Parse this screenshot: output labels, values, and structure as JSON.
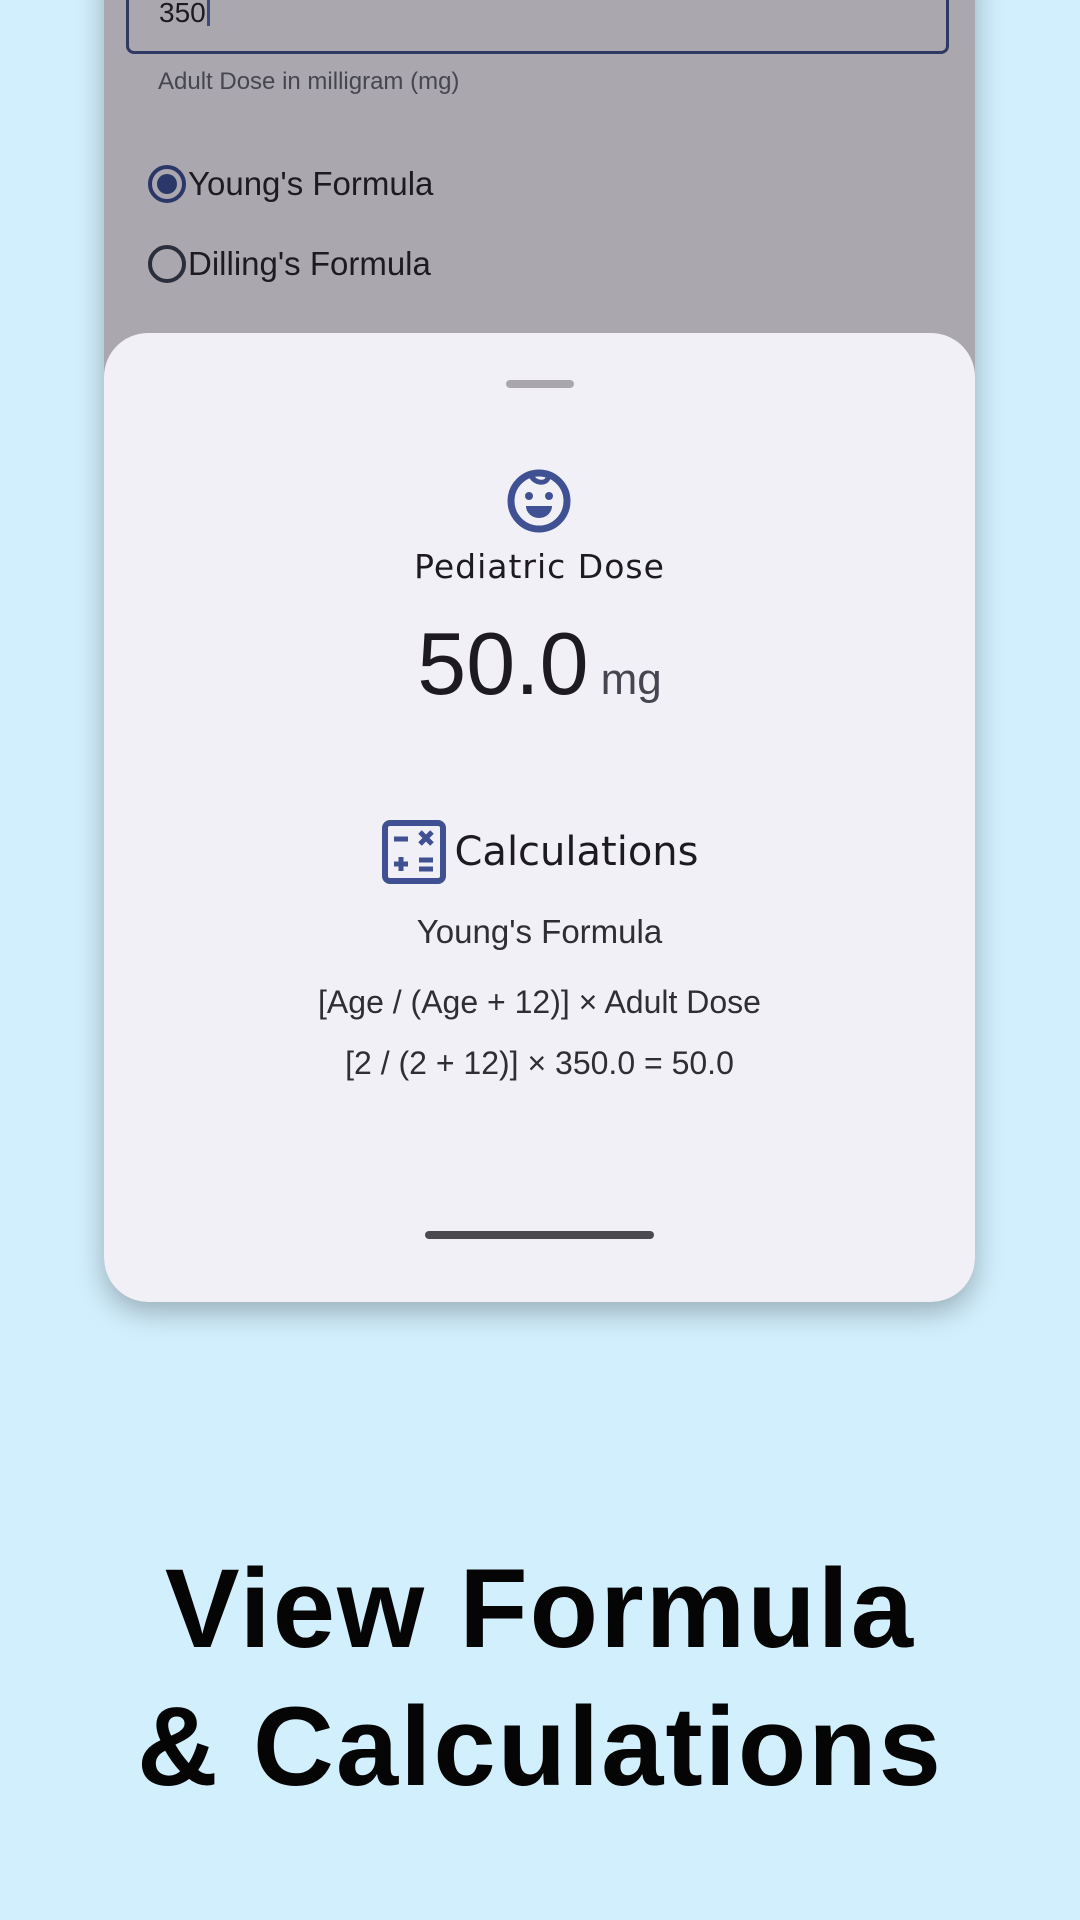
{
  "form": {
    "adult_dose_value": "350",
    "adult_dose_support": "Adult Dose in milligram (mg)",
    "radio_options": [
      {
        "label": "Young's Formula",
        "checked": true
      },
      {
        "label": "Dilling's Formula",
        "checked": false
      }
    ]
  },
  "sheet": {
    "icon": "baby-face-icon",
    "title": "Pediatric Dose",
    "dose_value": "50.0",
    "dose_unit": "mg",
    "calculations_icon": "calculator-icon",
    "calculations_title": "Calculations",
    "formula_name": "Young's Formula",
    "formula_expression": "[Age / (Age + 12)] × Adult Dose",
    "formula_result": "[2 / (2 + 12)] × 350.0 = 50.0"
  },
  "caption": {
    "line1": "View Formula",
    "line2": "& Calculations"
  },
  "colors": {
    "background": "#d2effd",
    "scrim": "#aaa8ae",
    "sheet": "#f2f0f7",
    "accent": "#3f5193"
  }
}
